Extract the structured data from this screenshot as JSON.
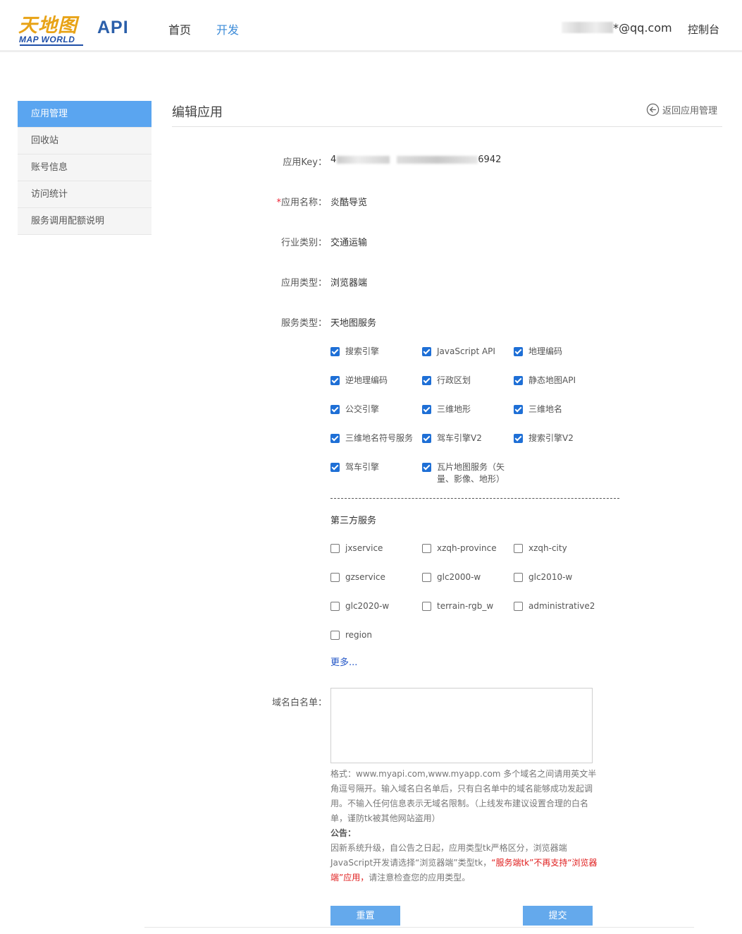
{
  "header": {
    "logo_cn": "天地图",
    "logo_en": "MAP WORLD",
    "api_label": "API",
    "nav": [
      {
        "label": "首页",
        "active": false
      },
      {
        "label": "开发",
        "active": true
      }
    ],
    "user_email_suffix": "*@qq.com",
    "console_label": "控制台"
  },
  "sidebar": {
    "items": [
      {
        "label": "应用管理",
        "active": true
      },
      {
        "label": "回收站",
        "active": false
      },
      {
        "label": "账号信息",
        "active": false
      },
      {
        "label": "访问统计",
        "active": false
      },
      {
        "label": "服务调用配额说明",
        "active": false
      }
    ]
  },
  "main": {
    "title": "编辑应用",
    "back_label": "返回应用管理",
    "form": {
      "key_label": "应用Key：",
      "key_prefix": "4",
      "key_suffix": "6942",
      "name_label": "应用名称：",
      "name_required": "*",
      "name_value": "炎酷导览",
      "industry_label": "行业类别：",
      "industry_value": "交通运输",
      "app_type_label": "应用类型：",
      "app_type_value": "浏览器端",
      "service_type_label": "服务类型：",
      "service_type_value": "天地图服务",
      "services": [
        {
          "label": "搜索引擎",
          "checked": true
        },
        {
          "label": "JavaScript API",
          "checked": true
        },
        {
          "label": "地理编码",
          "checked": true
        },
        {
          "label": "逆地理编码",
          "checked": true
        },
        {
          "label": "行政区划",
          "checked": true
        },
        {
          "label": "静态地图API",
          "checked": true
        },
        {
          "label": "公交引擎",
          "checked": true
        },
        {
          "label": "三维地形",
          "checked": true
        },
        {
          "label": "三维地名",
          "checked": true
        },
        {
          "label": "三维地名符号服务",
          "checked": true
        },
        {
          "label": "驾车引擎V2",
          "checked": true
        },
        {
          "label": "搜索引擎V2",
          "checked": true
        },
        {
          "label": "驾车引擎",
          "checked": true
        },
        {
          "label": "瓦片地图服务（矢量、影像、地形）",
          "checked": true
        }
      ],
      "third_party_title": "第三方服务",
      "third_party": [
        {
          "label": "jxservice",
          "checked": false
        },
        {
          "label": "xzqh-province",
          "checked": false
        },
        {
          "label": "xzqh-city",
          "checked": false
        },
        {
          "label": "gzservice",
          "checked": false
        },
        {
          "label": "glc2000-w",
          "checked": false
        },
        {
          "label": "glc2010-w",
          "checked": false
        },
        {
          "label": "glc2020-w",
          "checked": false
        },
        {
          "label": "terrain-rgb_w",
          "checked": false
        },
        {
          "label": "administrative2",
          "checked": false
        },
        {
          "label": "region",
          "checked": false
        }
      ],
      "more_label": "更多...",
      "whitelist_label": "域名白名单：",
      "whitelist_value": "",
      "hint_format": "格式：www.myapi.com,www.myapp.com 多个域名之间请用英文半角逗号隔开。输入域名白名单后，只有白名单中的域名能够成功发起调用。不输入任何信息表示无域名限制。（上线发布建议设置合理的白名单，谨防tk被其他网站盗用）",
      "notice_title": "公告：",
      "notice_text": "因新系统升级，自公告之日起，应用类型tk严格区分，浏览器端JavaScript开发请选择“浏览器端”类型tk，",
      "notice_red": "“服务端tk”不再支持“浏览器端”应用，",
      "notice_tail": "请注意检查您的应用类型。",
      "reset_label": "重置",
      "submit_label": "提交"
    }
  },
  "colors": {
    "accent": "#5aa5f0",
    "nav_active": "#3c8bd8",
    "checkbox": "#1e6fd6",
    "button": "#64a9ec",
    "warning": "#e02020",
    "link": "#2356c7"
  }
}
